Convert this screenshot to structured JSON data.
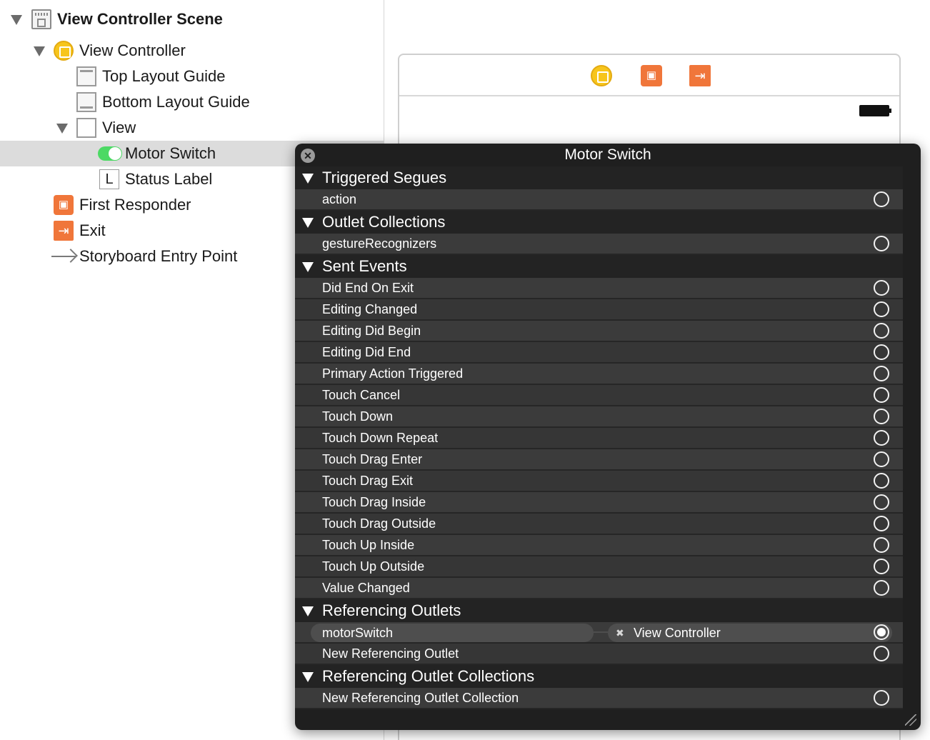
{
  "outline": {
    "scene": "View Controller Scene",
    "view_controller": "View Controller",
    "top_layout_guide": "Top Layout Guide",
    "bottom_layout_guide": "Bottom Layout Guide",
    "view": "View",
    "motor_switch": "Motor Switch",
    "status_label": "Status Label",
    "status_label_icon": "L",
    "first_responder": "First Responder",
    "exit": "Exit",
    "entry_point": "Storyboard Entry Point"
  },
  "popup": {
    "title": "Motor Switch",
    "sections": {
      "triggered_segues": {
        "title": "Triggered Segues",
        "items": [
          "action"
        ]
      },
      "outlet_collections": {
        "title": "Outlet Collections",
        "items": [
          "gestureRecognizers"
        ]
      },
      "sent_events": {
        "title": "Sent Events",
        "items": [
          "Did End On Exit",
          "Editing Changed",
          "Editing Did Begin",
          "Editing Did End",
          "Primary Action Triggered",
          "Touch Cancel",
          "Touch Down",
          "Touch Down Repeat",
          "Touch Drag Enter",
          "Touch Drag Exit",
          "Touch Drag Inside",
          "Touch Drag Outside",
          "Touch Up Inside",
          "Touch Up Outside",
          "Value Changed"
        ]
      },
      "referencing_outlets": {
        "title": "Referencing Outlets",
        "connected_outlet": "motorSwitch",
        "connected_target": "View Controller",
        "new_item": "New Referencing Outlet"
      },
      "referencing_outlet_collections": {
        "title": "Referencing Outlet Collections",
        "new_item": "New Referencing Outlet Collection"
      }
    }
  },
  "icons": {
    "close": "close-icon",
    "disclosure": "disclosure-triangle-icon",
    "connection": "connection-circle-icon"
  },
  "colors": {
    "popup_background": "#1f1f1f",
    "switch_on": "#4cd964",
    "view_controller_icon": "#f7c51c",
    "object_icon": "#f0763a"
  }
}
